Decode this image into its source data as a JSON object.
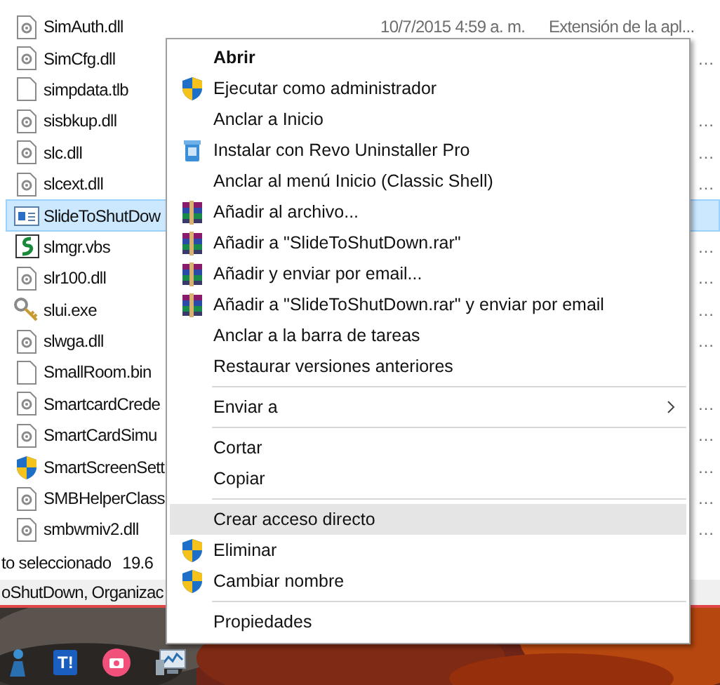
{
  "file_list": {
    "rows": [
      {
        "name": "SimAuth.dll",
        "kind": "dll",
        "date": "10/7/2015 4:59 a. m.",
        "type": "Extensión de la apl...",
        "selected": false
      },
      {
        "name": "SimCfg.dll",
        "kind": "dll",
        "type_end": "…",
        "selected": false
      },
      {
        "name": "simpdata.tlb",
        "kind": "blank",
        "selected": false
      },
      {
        "name": "sisbkup.dll",
        "kind": "dll",
        "type_end": "…",
        "selected": false
      },
      {
        "name": "slc.dll",
        "kind": "dll",
        "type_end": "…",
        "selected": false
      },
      {
        "name": "slcext.dll",
        "kind": "dll",
        "type_end": "…",
        "selected": false
      },
      {
        "name": "SlideToShutDow",
        "kind": "app",
        "selected": true
      },
      {
        "name": "slmgr.vbs",
        "kind": "script",
        "type_end": "…",
        "selected": false
      },
      {
        "name": "slr100.dll",
        "kind": "dll",
        "type_end": "…",
        "selected": false
      },
      {
        "name": "slui.exe",
        "kind": "key",
        "type_end": "…",
        "selected": false
      },
      {
        "name": "slwga.dll",
        "kind": "dll",
        "type_end": "…",
        "selected": false
      },
      {
        "name": "SmallRoom.bin",
        "kind": "blank",
        "selected": false
      },
      {
        "name": "SmartcardCrede",
        "kind": "dll",
        "type_end": "…",
        "selected": false
      },
      {
        "name": "SmartCardSimu",
        "kind": "dll",
        "type_end": "…",
        "selected": false
      },
      {
        "name": "SmartScreenSett",
        "kind": "shield",
        "type_end": "…",
        "selected": false
      },
      {
        "name": "SMBHelperClass",
        "kind": "dll",
        "type_end": "…",
        "selected": false
      },
      {
        "name": "smbwmiv2.dll",
        "kind": "dll",
        "type_end": "…",
        "selected": false
      }
    ]
  },
  "status_bar": {
    "text": "to seleccionado",
    "size": "19.6"
  },
  "details_bar": {
    "text": "oShutDown, Organizac"
  },
  "context_menu": {
    "items": [
      {
        "kind": "item",
        "label": "Abrir",
        "default": true,
        "highlighted": false
      },
      {
        "kind": "elevated",
        "label": "Ejecutar como administrador",
        "default": false,
        "highlighted": false
      },
      {
        "kind": "item",
        "label": "Anclar a Inicio",
        "default": false,
        "highlighted": false
      },
      {
        "kind": "installer",
        "label": "Instalar con Revo Uninstaller Pro",
        "default": false,
        "highlighted": false
      },
      {
        "kind": "item",
        "label": "Anclar al menú Inicio (Classic Shell)",
        "default": false,
        "highlighted": false
      },
      {
        "kind": "archive",
        "label": "Añadir al archivo...",
        "default": false,
        "highlighted": false
      },
      {
        "kind": "archive",
        "label": "Añadir a \"SlideToShutDown.rar\"",
        "default": false,
        "highlighted": false
      },
      {
        "kind": "archive",
        "label": "Añadir y enviar por email...",
        "default": false,
        "highlighted": false
      },
      {
        "kind": "archive",
        "label": "Añadir a \"SlideToShutDown.rar\" y enviar por email",
        "default": false,
        "highlighted": false
      },
      {
        "kind": "item",
        "label": "Anclar a la barra de tareas",
        "default": false,
        "highlighted": false
      },
      {
        "kind": "item",
        "label": "Restaurar versiones anteriores",
        "default": false,
        "highlighted": false
      },
      {
        "kind": "separator"
      },
      {
        "kind": "submenu",
        "label": "Enviar a",
        "default": false,
        "highlighted": false
      },
      {
        "kind": "separator"
      },
      {
        "kind": "item",
        "label": "Cortar",
        "default": false,
        "highlighted": false
      },
      {
        "kind": "item",
        "label": "Copiar",
        "default": false,
        "highlighted": false
      },
      {
        "kind": "separator"
      },
      {
        "kind": "item",
        "label": "Crear acceso directo",
        "default": false,
        "highlighted": true
      },
      {
        "kind": "elevated",
        "label": "Eliminar",
        "default": false,
        "highlighted": false
      },
      {
        "kind": "elevated",
        "label": "Cambiar nombre",
        "default": false,
        "highlighted": false
      },
      {
        "kind": "separator"
      },
      {
        "kind": "item",
        "label": "Propiedades",
        "default": false,
        "highlighted": false
      }
    ]
  },
  "taskbar": {
    "icons": [
      {
        "kind": "person"
      },
      {
        "kind": "badge",
        "label": "T!"
      },
      {
        "kind": "camera"
      },
      {
        "kind": "monitor"
      }
    ]
  }
}
